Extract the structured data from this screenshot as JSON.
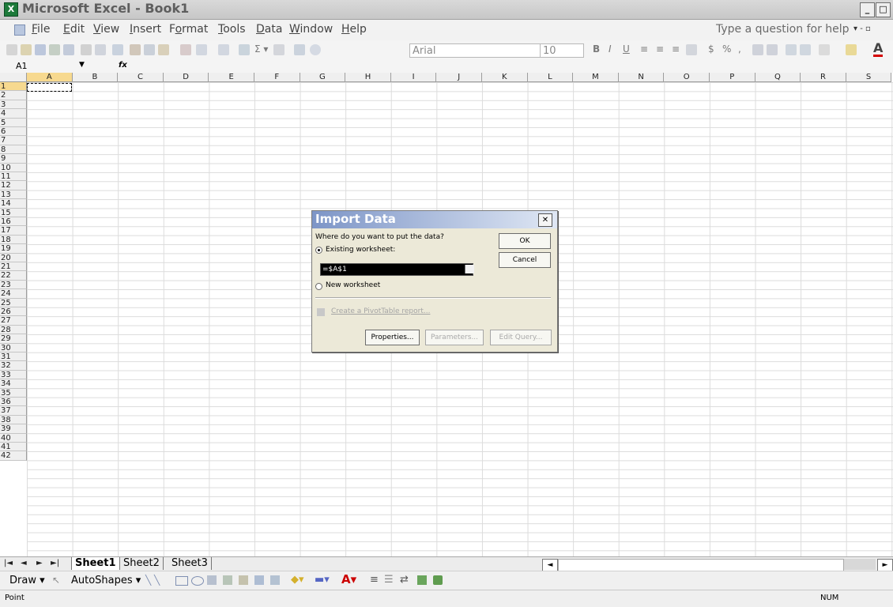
{
  "window": {
    "title": "Microsoft Excel - Book1",
    "app_icon": "excel-icon",
    "controls": [
      "_",
      "□"
    ]
  },
  "menu": {
    "items": [
      {
        "label": "File"
      },
      {
        "label": "Edit"
      },
      {
        "label": "View"
      },
      {
        "label": "Insert"
      },
      {
        "label": "Format"
      },
      {
        "label": "Tools"
      },
      {
        "label": "Data"
      },
      {
        "label": "Window"
      },
      {
        "label": "Help"
      }
    ],
    "help_placeholder": "Type a question for help"
  },
  "toolbar": {
    "font_name": "Arial",
    "font_size": "10",
    "bold": "B",
    "italic": "I",
    "underline": "U",
    "currency": "$",
    "percent": "%",
    "comma": ","
  },
  "formula_bar": {
    "name_box": "A1",
    "fx": "fx",
    "content": ""
  },
  "grid": {
    "columns": [
      "A",
      "B",
      "C",
      "D",
      "E",
      "F",
      "G",
      "H",
      "I",
      "J",
      "K",
      "L",
      "M",
      "N",
      "O",
      "P",
      "Q",
      "R",
      "S"
    ],
    "rows": [
      "1",
      "2",
      "3",
      "4",
      "5",
      "6",
      "7",
      "8",
      "9",
      "10",
      "11",
      "12",
      "13",
      "14",
      "15",
      "16",
      "17",
      "18",
      "19",
      "20",
      "21",
      "22",
      "23",
      "24",
      "25",
      "26",
      "27",
      "28",
      "29",
      "30",
      "31",
      "32",
      "33",
      "34",
      "35",
      "36",
      "37",
      "38",
      "39",
      "40",
      "41",
      "42"
    ],
    "selected_cell": "A1"
  },
  "sheet_tabs": [
    {
      "label": "Sheet1",
      "active": true
    },
    {
      "label": "Sheet2"
    },
    {
      "label": "Sheet3"
    }
  ],
  "draw_toolbar": {
    "draw": "Draw",
    "autoshapes": "AutoShapes"
  },
  "status": {
    "mode": "Point",
    "num": "NUM"
  },
  "dialog": {
    "title": "Import Data",
    "prompt": "Where do you want to put the data?",
    "existing_label": "Existing worksheet:",
    "existing_value": "=$A$1",
    "new_label": "New worksheet",
    "pivot_label": "Create a PivotTable report...",
    "ok": "OK",
    "cancel": "Cancel",
    "properties": "Properties...",
    "parameters": "Parameters...",
    "edit_query": "Edit Query...",
    "close": "✕",
    "selected_option": "existing"
  },
  "colors": {
    "title_gradient_left": "#7d95c7",
    "excel_green": "#1d7a3a"
  }
}
